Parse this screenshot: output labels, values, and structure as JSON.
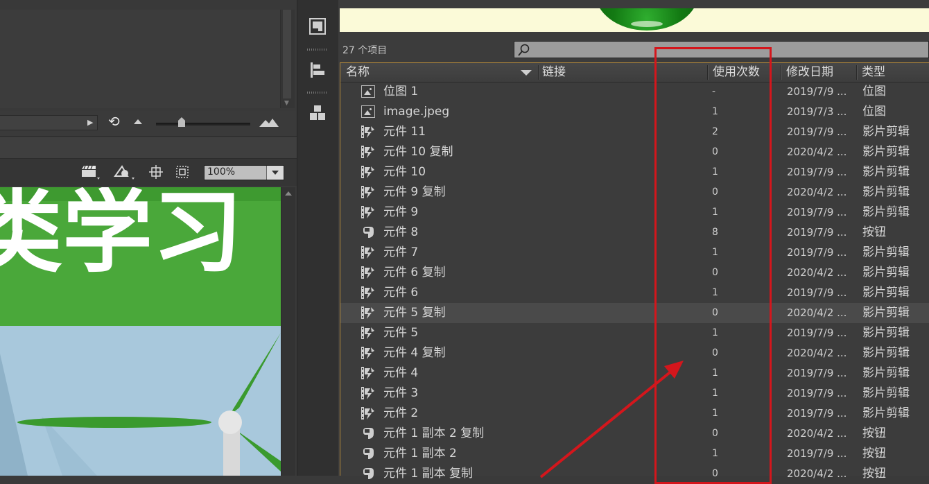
{
  "stage": {
    "zoom": "100%",
    "canvas_text": "类学习"
  },
  "library": {
    "item_count": "27 个项目",
    "search": {
      "placeholder": ""
    },
    "columns": {
      "name": "名称",
      "linkage": "链接",
      "use_count": "使用次数",
      "modified": "修改日期",
      "type": "类型"
    },
    "items": [
      {
        "icon": "bitmap-icon",
        "name": "位图 1",
        "use_count": "-",
        "modified": "2019/7/9 ...",
        "type": "位图"
      },
      {
        "icon": "bitmap-icon",
        "name": "image.jpeg",
        "use_count": "1",
        "modified": "2019/7/3 ...",
        "type": "位图"
      },
      {
        "icon": "movieclip-icon",
        "name": "元件 11",
        "use_count": "2",
        "modified": "2019/7/9 ...",
        "type": "影片剪辑"
      },
      {
        "icon": "movieclip-icon",
        "name": "元件 10 复制",
        "use_count": "0",
        "modified": "2020/4/2 ...",
        "type": "影片剪辑"
      },
      {
        "icon": "movieclip-icon",
        "name": "元件 10",
        "use_count": "1",
        "modified": "2019/7/9 ...",
        "type": "影片剪辑"
      },
      {
        "icon": "movieclip-icon",
        "name": "元件 9 复制",
        "use_count": "0",
        "modified": "2020/4/2 ...",
        "type": "影片剪辑"
      },
      {
        "icon": "movieclip-icon",
        "name": "元件 9",
        "use_count": "1",
        "modified": "2019/7/9 ...",
        "type": "影片剪辑"
      },
      {
        "icon": "button-icon",
        "name": "元件 8",
        "use_count": "8",
        "modified": "2019/7/9 ...",
        "type": "按钮"
      },
      {
        "icon": "movieclip-icon",
        "name": "元件 7",
        "use_count": "1",
        "modified": "2019/7/9 ...",
        "type": "影片剪辑"
      },
      {
        "icon": "movieclip-icon",
        "name": "元件 6 复制",
        "use_count": "0",
        "modified": "2020/4/2 ...",
        "type": "影片剪辑"
      },
      {
        "icon": "movieclip-icon",
        "name": "元件 6",
        "use_count": "1",
        "modified": "2019/7/9 ...",
        "type": "影片剪辑"
      },
      {
        "icon": "movieclip-icon",
        "name": "元件 5 复制",
        "use_count": "0",
        "modified": "2020/4/2 ...",
        "type": "影片剪辑",
        "selected": true
      },
      {
        "icon": "movieclip-icon",
        "name": "元件 5",
        "use_count": "1",
        "modified": "2019/7/9 ...",
        "type": "影片剪辑"
      },
      {
        "icon": "movieclip-icon",
        "name": "元件 4 复制",
        "use_count": "0",
        "modified": "2020/4/2 ...",
        "type": "影片剪辑"
      },
      {
        "icon": "movieclip-icon",
        "name": "元件 4",
        "use_count": "1",
        "modified": "2019/7/9 ...",
        "type": "影片剪辑"
      },
      {
        "icon": "movieclip-icon",
        "name": "元件 3",
        "use_count": "1",
        "modified": "2019/7/9 ...",
        "type": "影片剪辑"
      },
      {
        "icon": "movieclip-icon",
        "name": "元件 2",
        "use_count": "1",
        "modified": "2019/7/9 ...",
        "type": "影片剪辑"
      },
      {
        "icon": "button-icon",
        "name": "元件 1 副本 2 复制",
        "use_count": "0",
        "modified": "2020/4/2 ...",
        "type": "按钮"
      },
      {
        "icon": "button-icon",
        "name": "元件 1 副本 2",
        "use_count": "1",
        "modified": "2019/7/9 ...",
        "type": "按钮"
      },
      {
        "icon": "button-icon",
        "name": "元件 1 副本 复制",
        "use_count": "0",
        "modified": "2020/4/2 ...",
        "type": "按钮"
      }
    ]
  },
  "colors": {
    "annotation_red": "#d4161c",
    "panel_bg": "#3c3c3c",
    "selected_row": "#4a4a4a",
    "stage_green": "#4aa83a",
    "stage_sky": "#a8c8dc"
  }
}
